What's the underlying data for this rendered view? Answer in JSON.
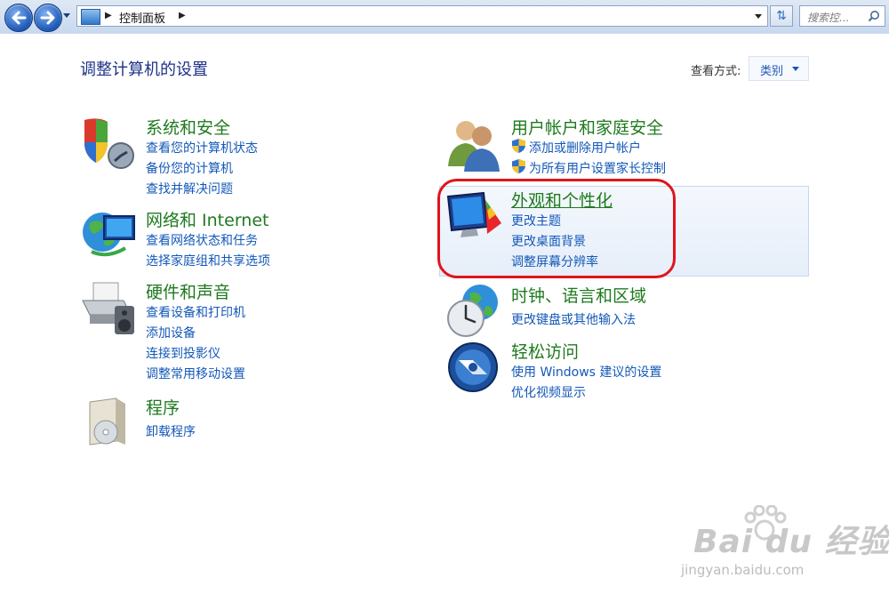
{
  "nav": {
    "address_path": "控制面板",
    "search_placeholder": "搜索控..."
  },
  "header": {
    "title": "调整计算机的设置",
    "view_by_label": "查看方式:",
    "view_by_value": "类别"
  },
  "categories": [
    {
      "title": "系统和安全",
      "links": [
        "查看您的计算机状态",
        "备份您的计算机",
        "查找并解决问题"
      ]
    },
    {
      "title": "网络和 Internet",
      "links": [
        "查看网络状态和任务",
        "选择家庭组和共享选项"
      ]
    },
    {
      "title": "硬件和声音",
      "links": [
        "查看设备和打印机",
        "添加设备",
        "连接到投影仪",
        "调整常用移动设置"
      ]
    },
    {
      "title": "程序",
      "links": [
        "卸载程序"
      ]
    },
    {
      "title": "用户帐户和家庭安全",
      "links": [
        "添加或删除用户帐户",
        "为所有用户设置家长控制"
      ]
    },
    {
      "title": "外观和个性化",
      "links": [
        "更改主题",
        "更改桌面背景",
        "调整屏幕分辨率"
      ]
    },
    {
      "title": "时钟、语言和区域",
      "links": [
        "更改键盘或其他输入法"
      ]
    },
    {
      "title": "轻松访问",
      "links": [
        "使用 Windows 建议的设置",
        "优化视频显示"
      ]
    }
  ],
  "watermark": {
    "brand": "Bai du 经验",
    "url": "jingyan.baidu.com"
  },
  "colors": {
    "heading_green": "#1f7a1f",
    "link_blue": "#1358b8",
    "title_blue": "#1e3287",
    "highlight_ring": "#e0141b"
  }
}
